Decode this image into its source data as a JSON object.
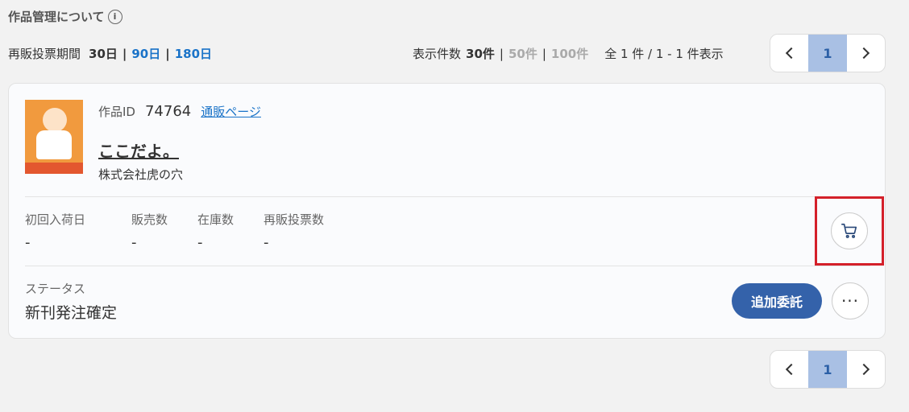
{
  "header": {
    "title": "作品管理について",
    "info_icon": "i"
  },
  "period": {
    "label": "再販投票期間",
    "options": [
      "30日",
      "90日",
      "180日"
    ],
    "selected": "30日"
  },
  "display_count": {
    "label": "表示件数",
    "options": [
      "30件",
      "50件",
      "100件"
    ],
    "selected": "30件",
    "total_text": "全 1 件 / 1 - 1 件表示"
  },
  "pagination": {
    "current_page": "1"
  },
  "work": {
    "id_label": "作品ID",
    "id": "74764",
    "link_label": "通販ページ",
    "title": "ここだよ。",
    "publisher": "株式会社虎の穴",
    "stats": [
      {
        "label": "初回入荷日",
        "value": "-"
      },
      {
        "label": "販売数",
        "value": "-"
      },
      {
        "label": "在庫数",
        "value": "-"
      },
      {
        "label": "再販投票数",
        "value": "-"
      }
    ],
    "status_label": "ステータス",
    "status_value": "新刊発注確定",
    "add_button_label": "追加委託",
    "more_button_label": "···"
  },
  "icons": {
    "cart": "cart-icon",
    "more": "more-icon",
    "prev": "chevron-left-icon",
    "next": "chevron-right-icon"
  },
  "colors": {
    "accent_blue": "#3462aa",
    "link_blue": "#1a73c8",
    "highlight_red": "#d4202a",
    "page_active": "#a9c0e4"
  }
}
